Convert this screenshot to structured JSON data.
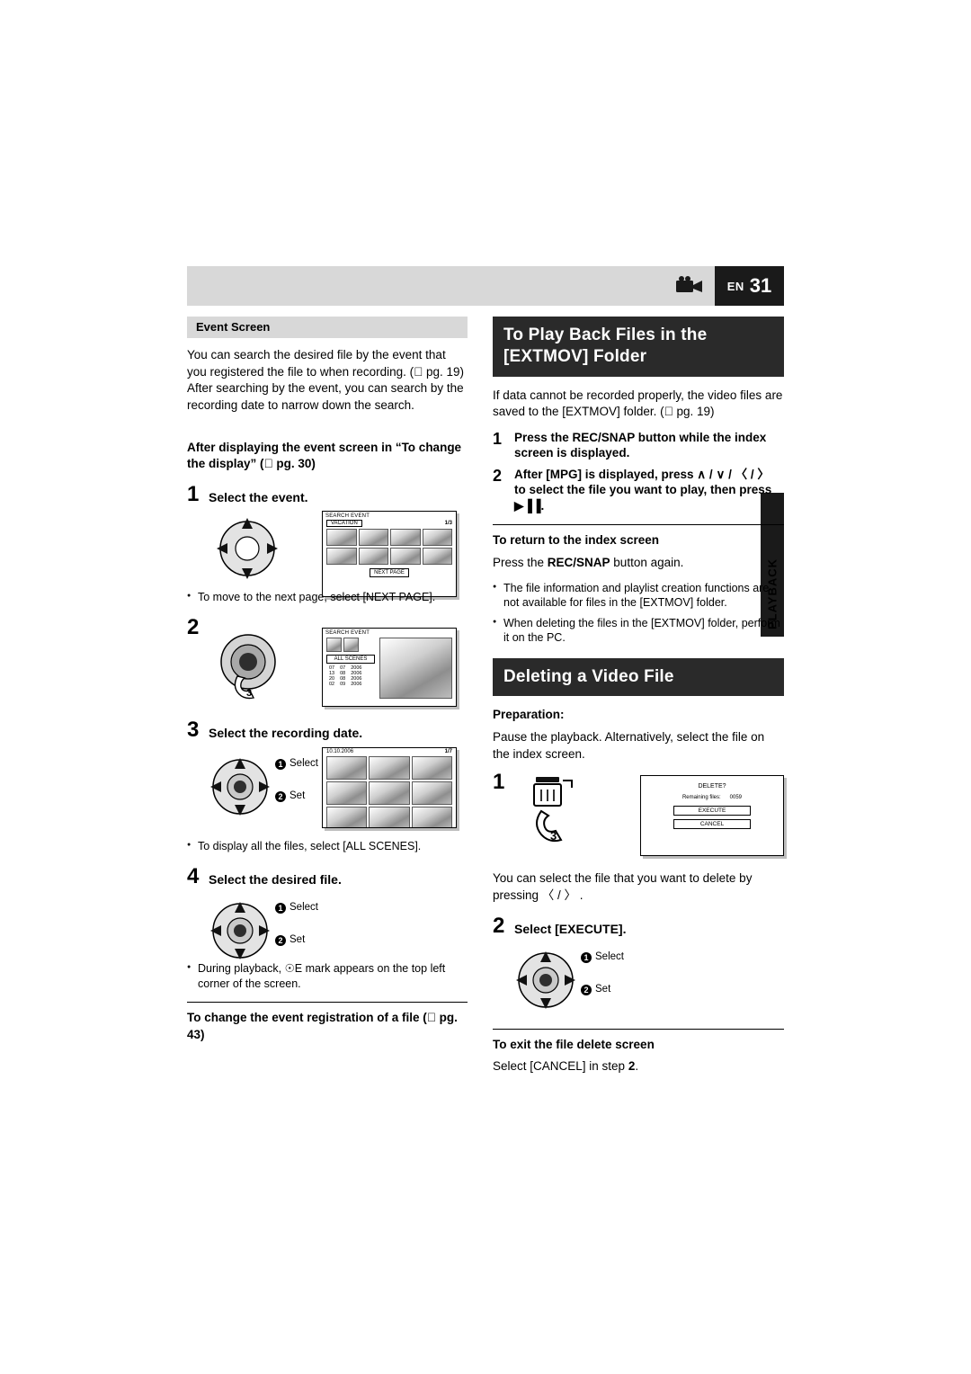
{
  "header": {
    "en_label": "EN",
    "page_number": "31",
    "camera_icon": "camcorder-icon"
  },
  "side_tab": {
    "label": "PLAYBACK"
  },
  "left_column": {
    "section_title": "Event Screen",
    "intro": "You can search the desired file by the event that you registered the file to when recording. ( pg. 19) After searching by the event, you can search by the recording date to narrow down the search.",
    "subheading": "After displaying the event screen in “To change the display” ( pg. 30)",
    "steps": [
      {
        "num": "1",
        "text": "Select the event."
      },
      {
        "num": "2",
        "text": ""
      },
      {
        "num": "3",
        "text": "Select the recording date."
      },
      {
        "num": "4",
        "text": "Select the desired file."
      }
    ],
    "bullets": [
      "To move to the next page, select [NEXT PAGE].",
      "To display all the files, select [ALL SCENES].",
      "During playback, ☉E  mark appears on the top left corner of the screen."
    ],
    "footer_heading": "To change the event registration of a file ( pg. 43)",
    "screen1": {
      "title": "SEARCH EVENT",
      "event_name": "VACATION",
      "page_indicator": "1/3",
      "next_page_button": "NEXT PAGE"
    },
    "screen2": {
      "title": "SEARCH EVENT",
      "all_scenes_button": "ALL SCENES",
      "date_rows": [
        [
          "07",
          "07",
          "2006"
        ],
        [
          "13",
          "08",
          "2006"
        ],
        [
          "20",
          "08",
          "2006"
        ],
        [
          "02",
          "09",
          "2006"
        ]
      ]
    },
    "screen3": {
      "date_label": "10.10.2006",
      "page_indicator": "1/7"
    },
    "select_label": "Select",
    "set_label": "Set"
  },
  "right_column": {
    "section1": {
      "title": "To Play Back Files in the [EXTMOV] Folder",
      "intro": "If data cannot be recorded properly, the video files are saved to the [EXTMOV] folder. ( pg. 19)",
      "steps": [
        {
          "num": "1",
          "text": "Press the REC/SNAP button while the index screen is displayed."
        },
        {
          "num": "2",
          "text": "After [MPG] is displayed, press  ∧ / ∨ / 〈 / 〉  to select the file you want to play, then press ▶▐▐."
        }
      ],
      "return_heading": "To return to the index screen",
      "return_text_pre": "Press the ",
      "return_text_bold": "REC/SNAP",
      "return_text_post": " button again.",
      "bullets": [
        "The file information and playlist creation functions are not available for files in the [EXTMOV] folder.",
        "When deleting the files in the [EXTMOV] folder, perform it on the PC."
      ]
    },
    "section2": {
      "title": "Deleting a Video File",
      "prep_heading": "Preparation:",
      "prep_text": "Pause the playback. Alternatively, select the file on the index screen.",
      "steps": [
        {
          "num": "1",
          "text": ""
        },
        {
          "num": "2",
          "text": "Select [EXECUTE]."
        }
      ],
      "note": "You can select the file that you want to delete by pressing 〈 / 〉 .",
      "exit_heading": "To exit the file delete screen",
      "exit_text_pre": "Select [CANCEL] in step ",
      "exit_text_bold": "2",
      "exit_text_post": ".",
      "delete_screen": {
        "title": "DELETE?",
        "remaining_label": "Remaining files:",
        "remaining_value": "0059",
        "execute_button": "EXECUTE",
        "cancel_button": "CANCEL"
      },
      "select_label": "Select",
      "set_label": "Set"
    }
  }
}
